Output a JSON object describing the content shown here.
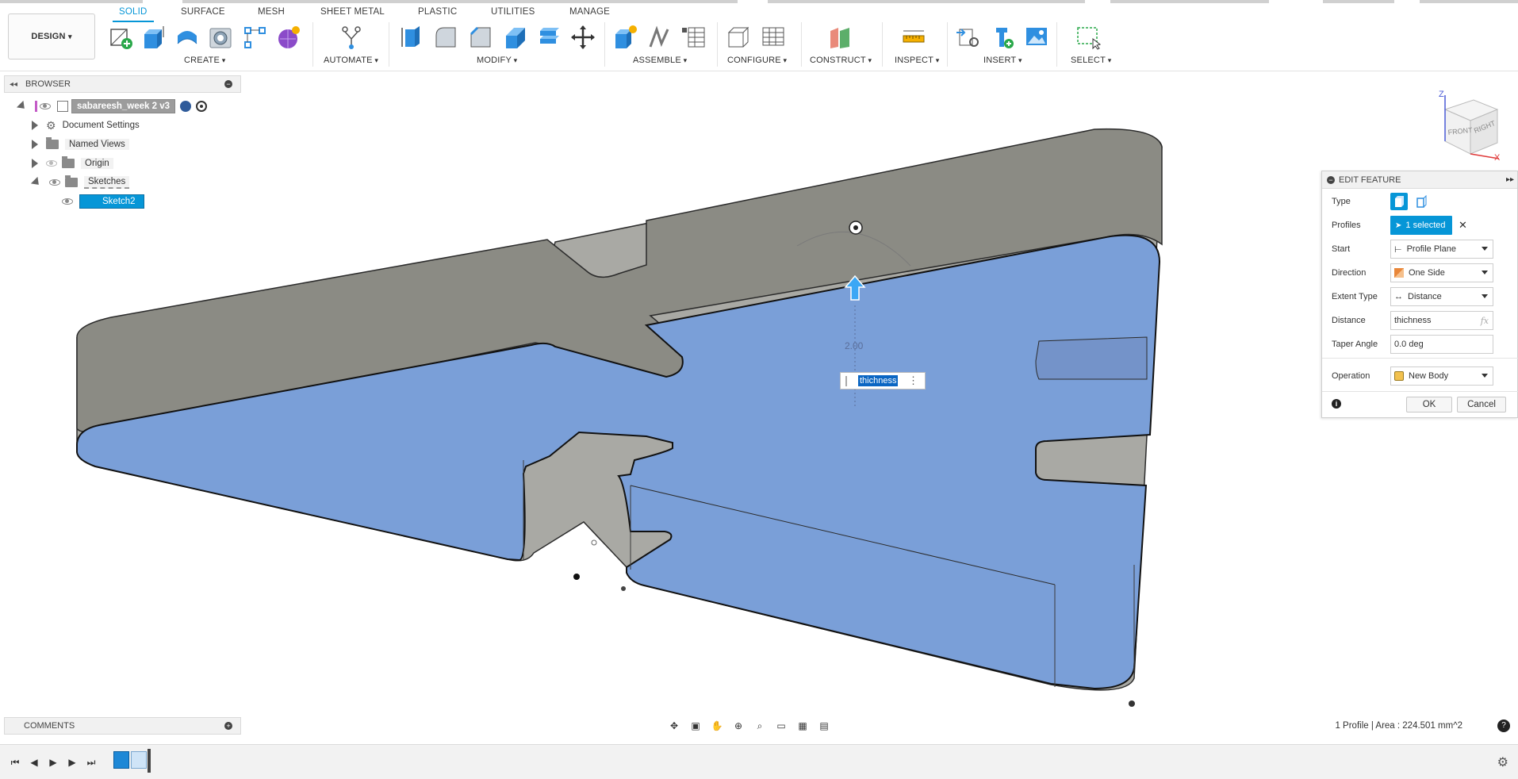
{
  "toolbar": {
    "design_label": "DESIGN",
    "tabs": [
      "SOLID",
      "SURFACE",
      "MESH",
      "SHEET METAL",
      "PLASTIC",
      "UTILITIES",
      "MANAGE"
    ],
    "groups": [
      "CREATE",
      "AUTOMATE",
      "MODIFY",
      "ASSEMBLE",
      "CONFIGURE",
      "CONSTRUCT",
      "INSPECT",
      "INSERT",
      "SELECT"
    ]
  },
  "browser": {
    "title": "BROWSER",
    "root": "sabareesh_week 2 v3",
    "items": [
      {
        "label": "Document Settings"
      },
      {
        "label": "Named Views"
      },
      {
        "label": "Origin"
      },
      {
        "label": "Sketches"
      },
      {
        "label": "Sketch2"
      }
    ]
  },
  "viewcube": {
    "front": "FRONT",
    "right": "RIGHT",
    "z": "Z",
    "x": "X"
  },
  "viewport": {
    "dimension_value": "2.00",
    "distance_input": "thichness"
  },
  "edit_feature": {
    "title": "EDIT FEATURE",
    "type_label": "Type",
    "profiles_label": "Profiles",
    "profiles_value": "1 selected",
    "start_label": "Start",
    "start_value": "Profile Plane",
    "direction_label": "Direction",
    "direction_value": "One Side",
    "extent_label": "Extent Type",
    "extent_value": "Distance",
    "distance_label": "Distance",
    "distance_value": "thichness",
    "fx": "fx",
    "taper_label": "Taper Angle",
    "taper_value": "0.0 deg",
    "operation_label": "Operation",
    "operation_value": "New Body",
    "ok": "OK",
    "cancel": "Cancel"
  },
  "comments": {
    "title": "COMMENTS"
  },
  "status": {
    "text": "1 Profile | Area : 224.501 mm^2"
  },
  "colors": {
    "accent": "#0696d7",
    "profile_fill": "#7a9fd8",
    "body_top": "#8b8b84",
    "wall": "#a7a7a2"
  }
}
